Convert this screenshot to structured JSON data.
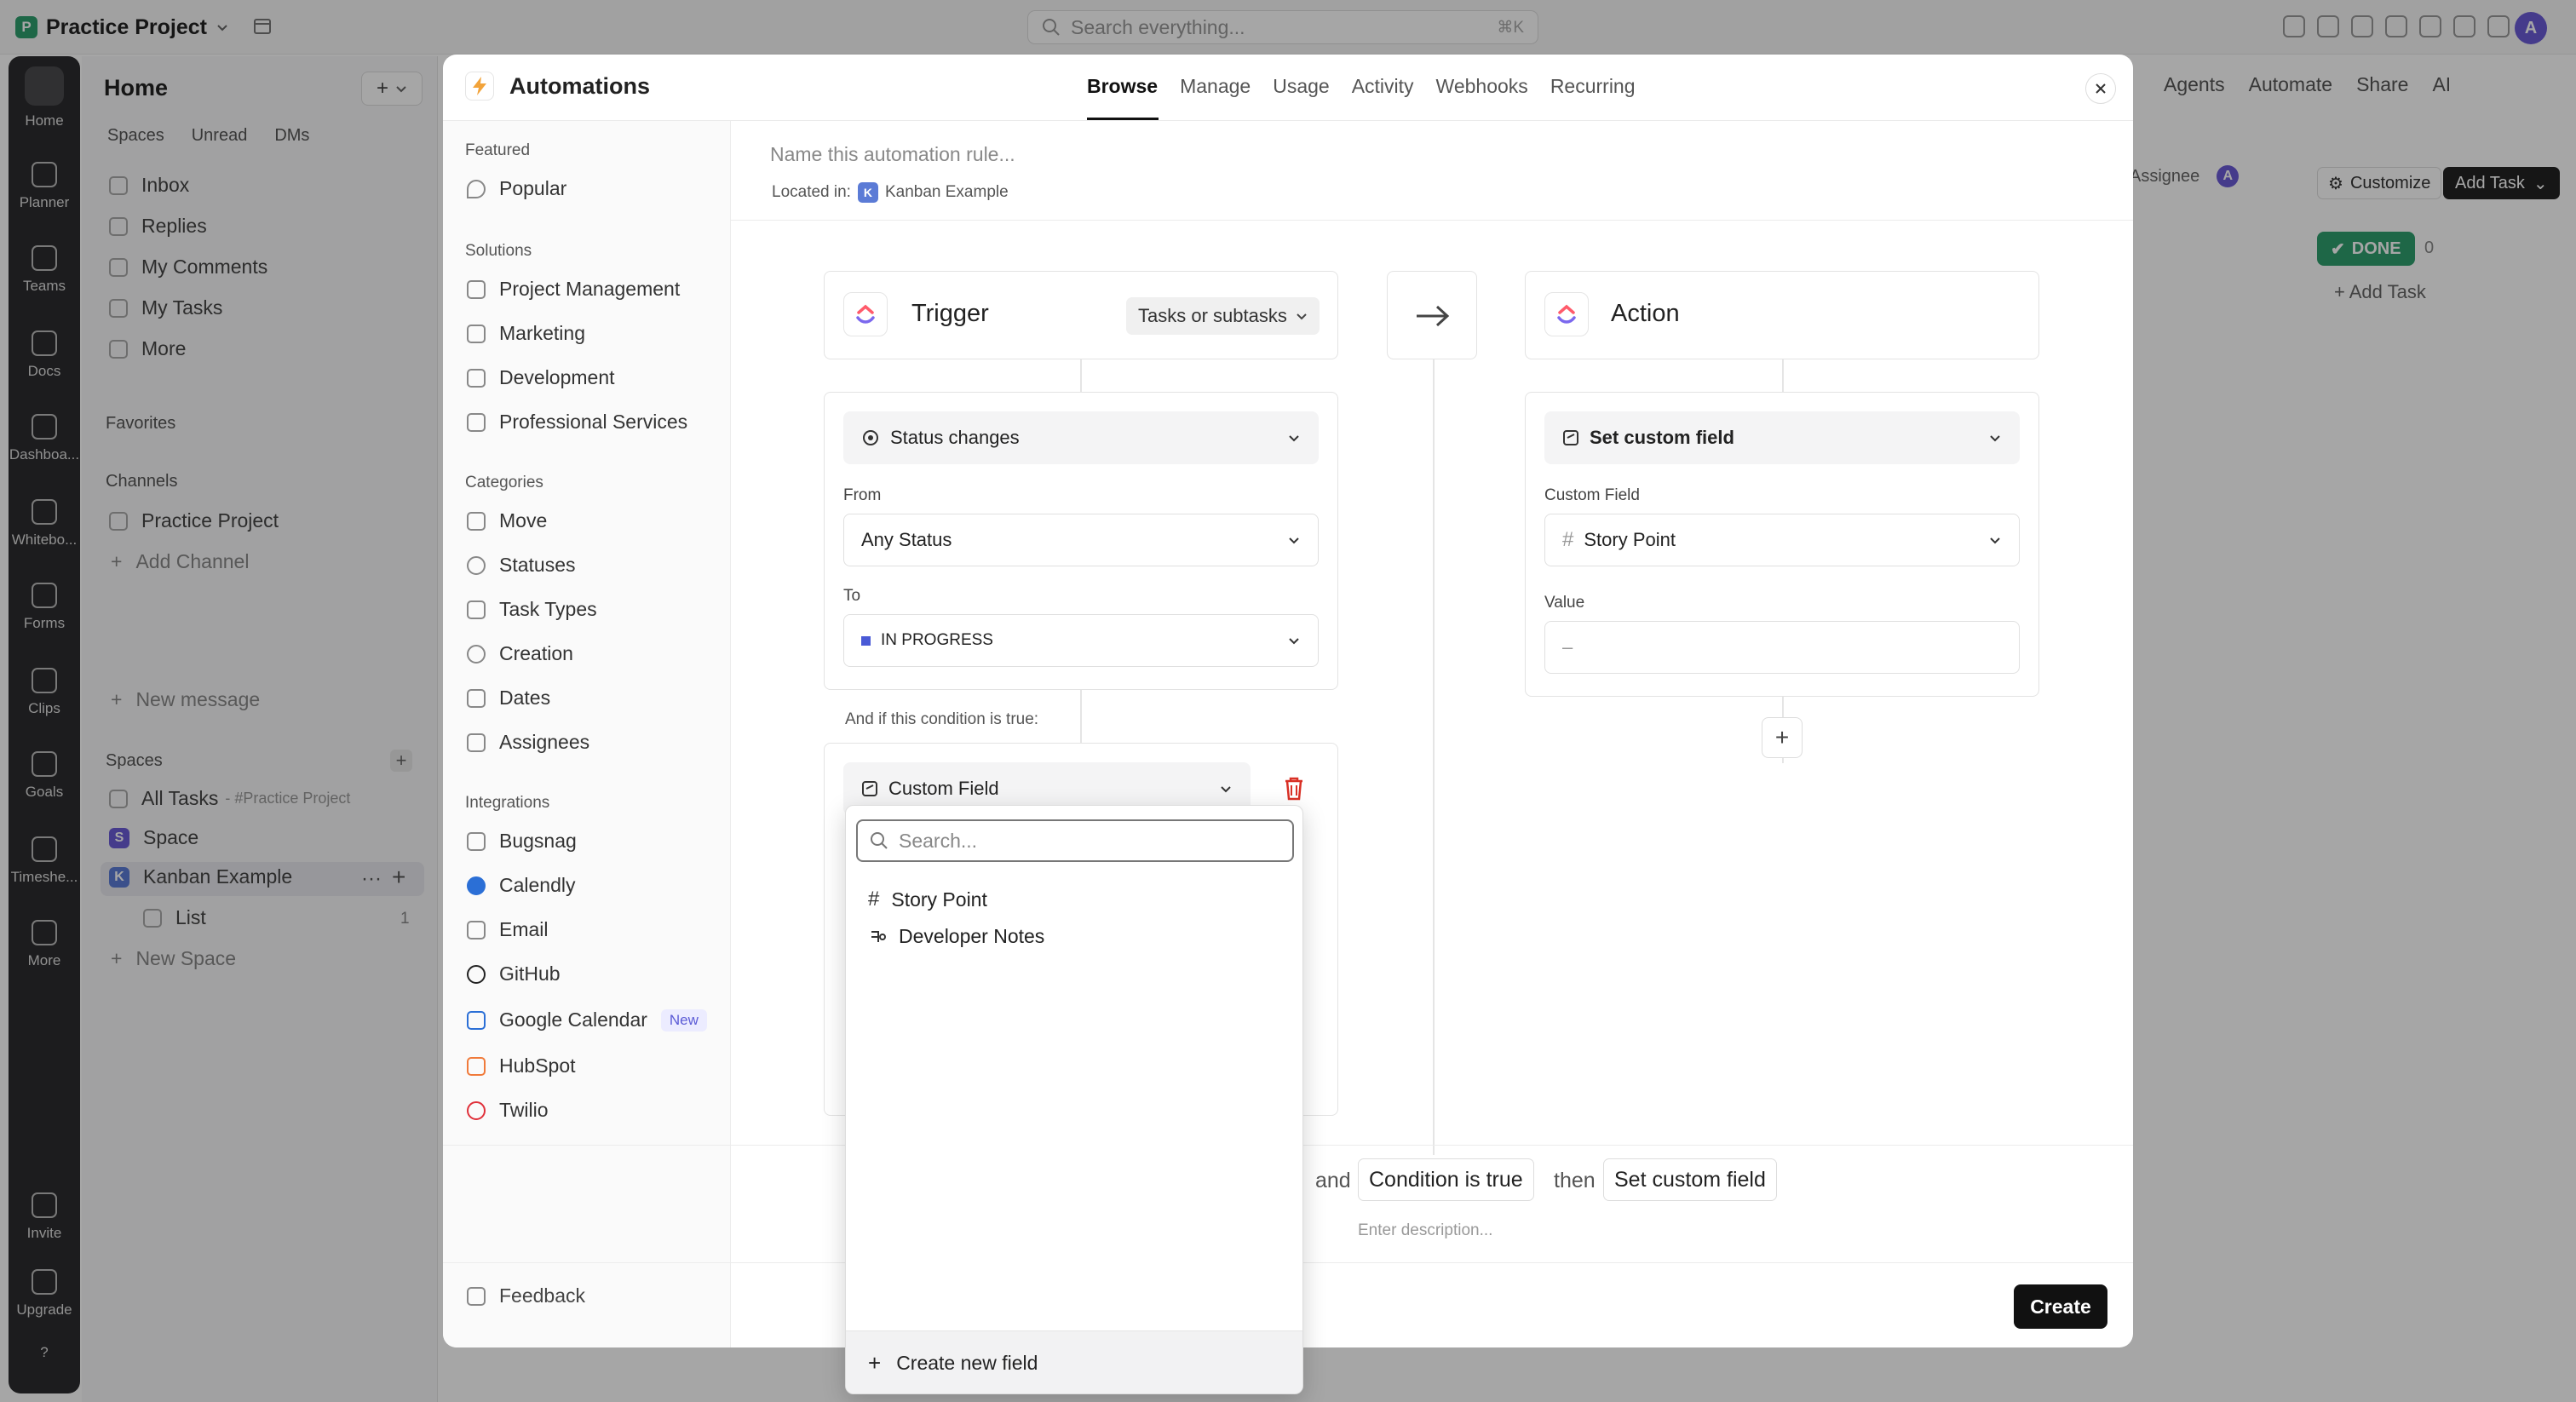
{
  "topbar": {
    "project_badge": "P",
    "project": "Practice Project",
    "search_placeholder": "Search everything...",
    "search_shortcut": "⌘K",
    "avatar": "A"
  },
  "rail": {
    "items": [
      "Home",
      "Planner",
      "Teams",
      "Docs",
      "Dashboa...",
      "Whitebo...",
      "Forms",
      "Clips",
      "Goals",
      "Timeshe...",
      "More"
    ],
    "invite": "Invite",
    "upgrade": "Upgrade",
    "help": "?"
  },
  "sidebar": {
    "title": "Home",
    "plus": "+",
    "tabs": [
      "Spaces",
      "Unread",
      "DMs"
    ],
    "nav": [
      "Inbox",
      "Replies",
      "My Comments",
      "My Tasks",
      "More"
    ],
    "favorites": "Favorites",
    "channels": "Channels",
    "channel_item": "Practice Project",
    "add_channel": "Add Channel",
    "new_message": "New message",
    "spaces": "Spaces",
    "all_tasks": "All Tasks",
    "all_tasks_sub": "- #Practice Project",
    "space_badge": "S",
    "space": "Space",
    "kanban_badge": "K",
    "kanban": "Kanban Example",
    "list": "List",
    "list_count": "1",
    "new_space": "New Space"
  },
  "background": {
    "agents": "Agents",
    "automate": "Automate",
    "share": "Share",
    "ai": "AI",
    "assignee": "Assignee",
    "assignee_avatar": "A",
    "customize": "Customize",
    "add_task": "Add Task",
    "done": "DONE",
    "done_count": "0",
    "add_task_col": "+ Add Task"
  },
  "modal": {
    "title": "Automations",
    "tabs": [
      "Browse",
      "Manage",
      "Usage",
      "Activity",
      "Webhooks",
      "Recurring"
    ],
    "left": {
      "featured": "Featured",
      "popular": "Popular",
      "solutions": "Solutions",
      "solution_items": [
        "Project Management",
        "Marketing",
        "Development",
        "Professional Services"
      ],
      "categories": "Categories",
      "category_items": [
        "Move",
        "Statuses",
        "Task Types",
        "Creation",
        "Dates",
        "Assignees"
      ],
      "integrations": "Integrations",
      "integration_items": [
        "Bugsnag",
        "Calendly",
        "Email",
        "GitHub",
        "Google Calendar",
        "HubSpot",
        "Twilio"
      ],
      "new_tag": "New",
      "feedback": "Feedback"
    },
    "rule_name_placeholder": "Name this automation rule...",
    "located_in": "Located in:",
    "located_badge": "K",
    "located_value": "Kanban Example",
    "trigger": {
      "title": "Trigger",
      "scope": "Tasks or subtasks",
      "event": "Status changes",
      "from_label": "From",
      "from_value": "Any Status",
      "to_label": "To",
      "to_value": "IN PROGRESS"
    },
    "condition": {
      "label": "And if this condition is true:",
      "field": "Custom Field"
    },
    "action": {
      "title": "Action",
      "event": "Set custom field",
      "field_label": "Custom Field",
      "field_value": "Story Point",
      "value_label": "Value",
      "value_placeholder": "–"
    },
    "sentence": {
      "and": "and",
      "condition": "Condition is true",
      "then": "then",
      "action": "Set custom field",
      "description_placeholder": "Enter description..."
    },
    "create": "Create"
  },
  "dropdown": {
    "search_placeholder": "Search...",
    "items": [
      "Story Point",
      "Developer Notes"
    ],
    "create_new": "Create new field"
  },
  "colors": {
    "accent": "#6b5bd6",
    "status_in_progress": "#4a5ad6",
    "done_green": "#2f9e6e",
    "danger": "#d93025"
  }
}
